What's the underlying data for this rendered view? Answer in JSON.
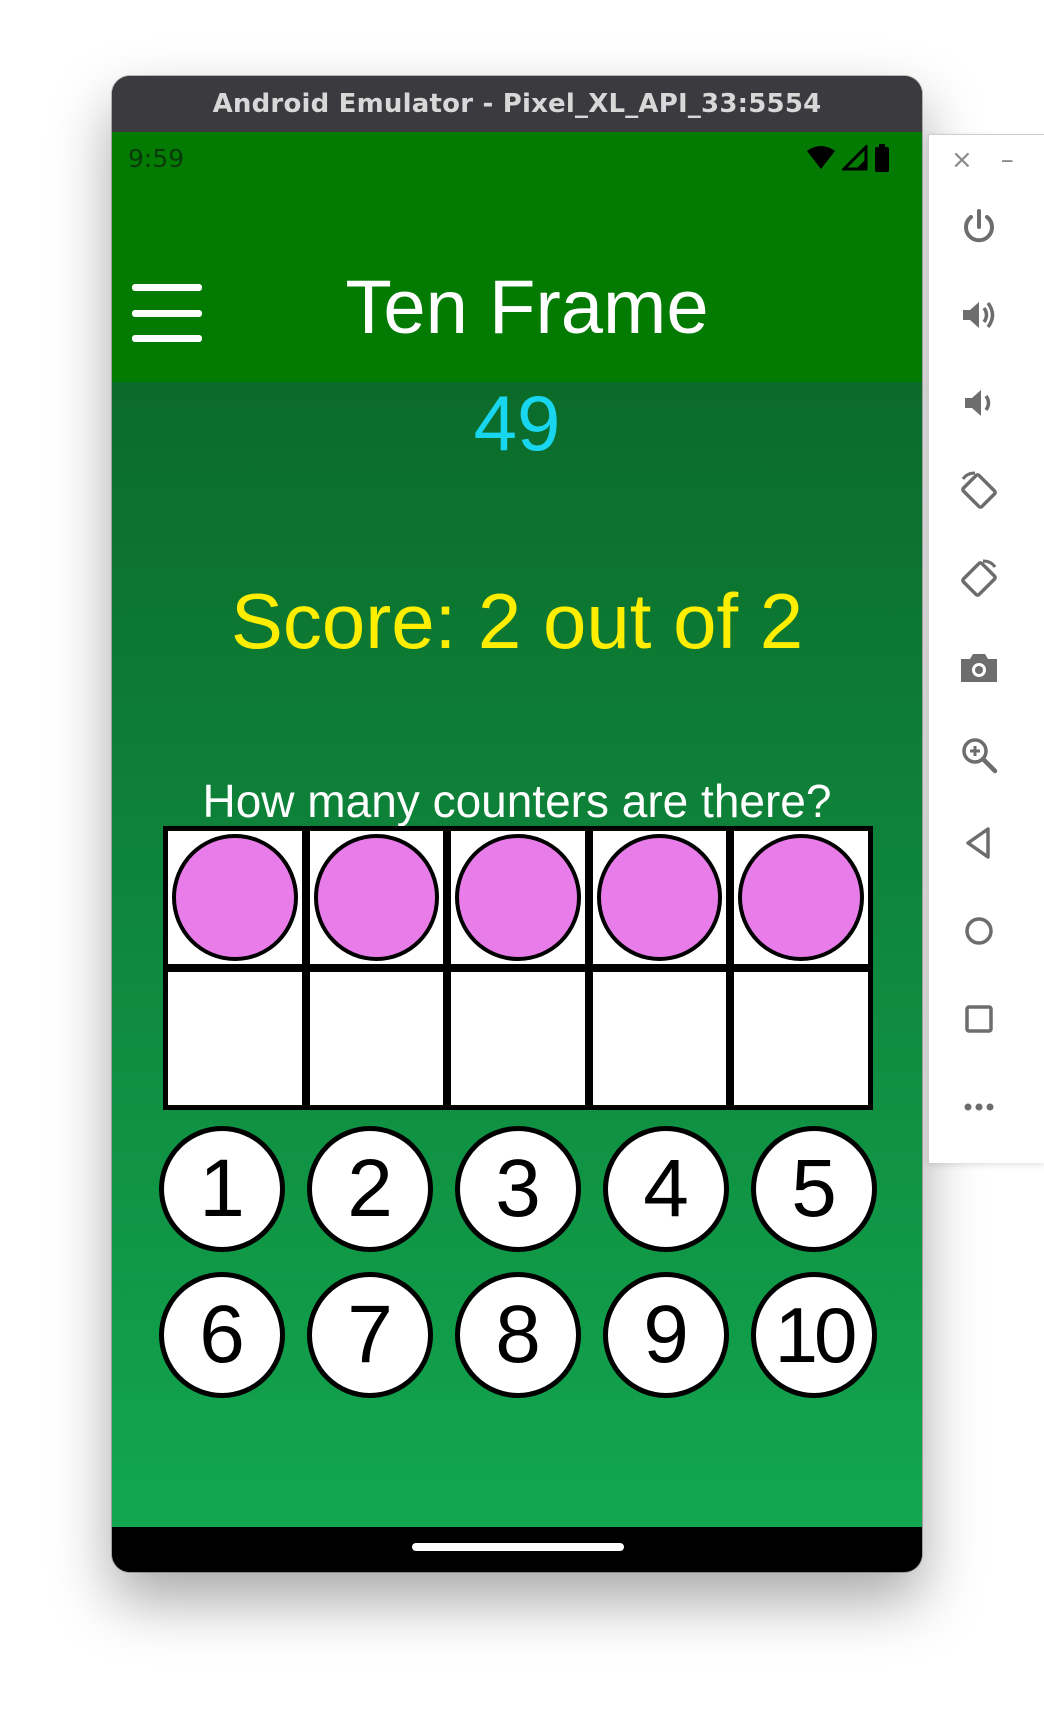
{
  "emulator": {
    "window_title": "Android Emulator - Pixel_XL_API_33:5554"
  },
  "status_bar": {
    "time": "9:59",
    "icons": [
      "wifi-icon",
      "cell-signal-icon",
      "battery-icon"
    ]
  },
  "app_bar": {
    "title": "Ten Frame",
    "menu_icon": "hamburger-menu-icon"
  },
  "game": {
    "counter_value": "49",
    "score": "Score: 2 out of 2",
    "question": "How many counters are there?",
    "ten_frame": {
      "filled_count": 5,
      "total_cells": 10,
      "counter_color": "#e87ce8"
    },
    "answers": [
      "1",
      "2",
      "3",
      "4",
      "5",
      "6",
      "7",
      "8",
      "9",
      "10"
    ]
  },
  "side_toolbar": {
    "window_controls": [
      "close-icon",
      "minimize-icon"
    ],
    "close_label": "×",
    "minimize_label": "–",
    "tools": [
      "power-icon",
      "volume-up-icon",
      "volume-down-icon",
      "rotate-left-icon",
      "rotate-right-icon",
      "camera-icon",
      "zoom-icon",
      "back-icon",
      "home-icon",
      "overview-icon",
      "more-icon"
    ]
  },
  "colors": {
    "app_bar": "#037b03",
    "background_top": "#0b6b2a",
    "background_bottom": "#12a650",
    "counter_value": "#19d6f0",
    "score": "#ffee00",
    "title_bar": "#3b3a3e"
  }
}
